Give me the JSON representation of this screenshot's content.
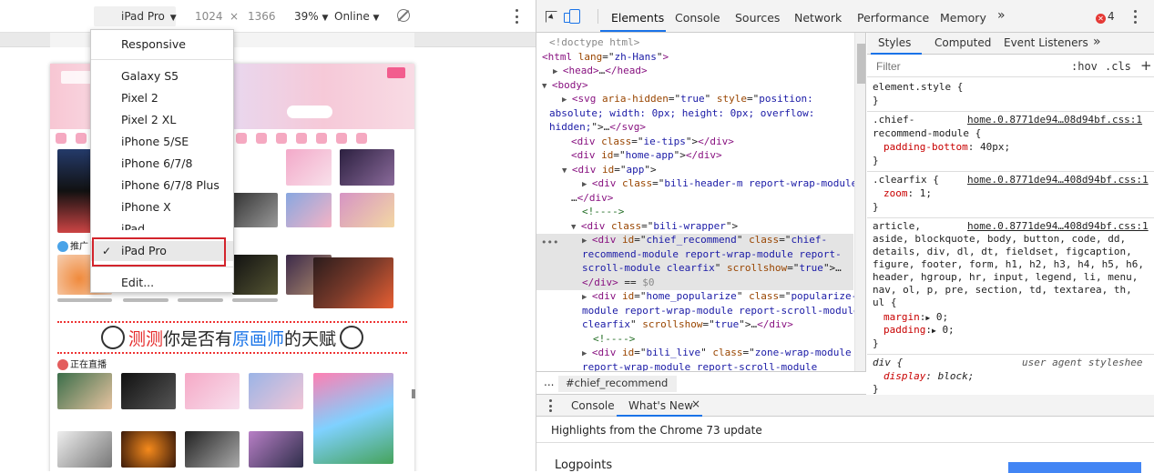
{
  "device_toolbar": {
    "device": "iPad Pro",
    "width": "1024",
    "times": "×",
    "height": "1366",
    "zoom": "39%",
    "network": "Online",
    "caret": "▼"
  },
  "device_menu": {
    "items": [
      "Responsive",
      "Galaxy S5",
      "Pixel 2",
      "Pixel 2 XL",
      "iPhone 5/SE",
      "iPhone 6/7/8",
      "iPhone 6/7/8 Plus",
      "iPhone X",
      "iPad",
      "iPad Pro",
      "Edit..."
    ],
    "selected": "iPad Pro",
    "check": "✓"
  },
  "page_preview": {
    "section_1": "推广",
    "section_2": "正在直播",
    "ad_parts": [
      "测测",
      "你是否有",
      "原画师",
      "的天赋"
    ]
  },
  "devtools": {
    "tabs": [
      "Elements",
      "Console",
      "Sources",
      "Network",
      "Performance",
      "Memory"
    ],
    "more": "»",
    "error_count": "4",
    "error_symbol": "✕"
  },
  "elements": {
    "lines": [
      {
        "parts": [
          [
            "g",
            "<!doctype html>"
          ]
        ]
      },
      {
        "parts": [
          [
            "t",
            "<html "
          ],
          [
            "a",
            "lang"
          ],
          [
            "k",
            "=\""
          ],
          [
            "v",
            "zh-Hans"
          ],
          [
            "k",
            "\""
          ],
          [
            "t",
            ">"
          ]
        ]
      },
      {
        "parts": [
          [
            "t",
            "<head>"
          ],
          [
            "k",
            "…"
          ],
          [
            "t",
            "</head>"
          ]
        ]
      },
      {
        "parts": [
          [
            "t",
            "<body>"
          ]
        ]
      },
      {
        "parts": [
          [
            "t",
            "<svg "
          ],
          [
            "a",
            "aria-hidden"
          ],
          [
            "k",
            "=\""
          ],
          [
            "v",
            "true"
          ],
          [
            "k",
            "\" "
          ],
          [
            "a",
            "style"
          ],
          [
            "k",
            "=\""
          ],
          [
            "v",
            "position:"
          ]
        ]
      },
      {
        "parts": [
          [
            "v",
            "absolute; width: 0px; height: 0px; overflow:"
          ]
        ]
      },
      {
        "parts": [
          [
            "v",
            "hidden;"
          ],
          [
            "k",
            "\">…"
          ],
          [
            "t",
            "</svg>"
          ]
        ]
      },
      {
        "parts": [
          [
            "t",
            "<div "
          ],
          [
            "a",
            "class"
          ],
          [
            "k",
            "=\""
          ],
          [
            "v",
            "ie-tips"
          ],
          [
            "k",
            "\">"
          ],
          [
            "t",
            "</div>"
          ]
        ]
      },
      {
        "parts": [
          [
            "t",
            "<div "
          ],
          [
            "a",
            "id"
          ],
          [
            "k",
            "=\""
          ],
          [
            "v",
            "home-app"
          ],
          [
            "k",
            "\">"
          ],
          [
            "t",
            "</div>"
          ]
        ]
      },
      {
        "parts": [
          [
            "t",
            "<div "
          ],
          [
            "a",
            "id"
          ],
          [
            "k",
            "=\""
          ],
          [
            "v",
            "app"
          ],
          [
            "k",
            "\">"
          ]
        ]
      },
      {
        "parts": [
          [
            "t",
            "<div "
          ],
          [
            "a",
            "class"
          ],
          [
            "k",
            "=\""
          ],
          [
            "v",
            "bili-header-m report-wrap-module"
          ],
          [
            "k",
            "\">"
          ]
        ]
      },
      {
        "parts": [
          [
            "k",
            "…"
          ],
          [
            "t",
            "</div>"
          ]
        ]
      },
      {
        "parts": [
          [
            "c",
            "<!---->"
          ]
        ]
      },
      {
        "parts": [
          [
            "t",
            "<div "
          ],
          [
            "a",
            "class"
          ],
          [
            "k",
            "=\""
          ],
          [
            "v",
            "bili-wrapper"
          ],
          [
            "k",
            "\">"
          ]
        ]
      },
      {
        "parts": [
          [
            "t",
            "<div "
          ],
          [
            "a",
            "id"
          ],
          [
            "k",
            "=\""
          ],
          [
            "v",
            "chief_recommend"
          ],
          [
            "k",
            "\" "
          ],
          [
            "a",
            "class"
          ],
          [
            "k",
            "=\""
          ],
          [
            "v",
            "chief-"
          ]
        ]
      },
      {
        "parts": [
          [
            "v",
            "recommend-module report-wrap-module report-"
          ]
        ]
      },
      {
        "parts": [
          [
            "v",
            "scroll-module clearfix"
          ],
          [
            "k",
            "\" "
          ],
          [
            "a",
            "scrollshow"
          ],
          [
            "k",
            "=\""
          ],
          [
            "v",
            "true"
          ],
          [
            "k",
            "\">…"
          ]
        ]
      },
      {
        "parts": [
          [
            "t",
            "</div>"
          ],
          [
            "k",
            " == "
          ],
          [
            "g",
            "$0"
          ]
        ]
      },
      {
        "parts": [
          [
            "t",
            "<div "
          ],
          [
            "a",
            "id"
          ],
          [
            "k",
            "=\""
          ],
          [
            "v",
            "home_popularize"
          ],
          [
            "k",
            "\" "
          ],
          [
            "a",
            "class"
          ],
          [
            "k",
            "=\""
          ],
          [
            "v",
            "popularize-"
          ]
        ]
      },
      {
        "parts": [
          [
            "v",
            "module report-wrap-module report-scroll-module"
          ]
        ]
      },
      {
        "parts": [
          [
            "v",
            "clearfix"
          ],
          [
            "k",
            "\" "
          ],
          [
            "a",
            "scrollshow"
          ],
          [
            "k",
            "=\""
          ],
          [
            "v",
            "true"
          ],
          [
            "k",
            "\">…"
          ],
          [
            "t",
            "</div>"
          ]
        ]
      },
      {
        "parts": [
          [
            "c",
            "<!---->"
          ]
        ]
      },
      {
        "parts": [
          [
            "t",
            "<div "
          ],
          [
            "a",
            "id"
          ],
          [
            "k",
            "=\""
          ],
          [
            "v",
            "bili_live"
          ],
          [
            "k",
            "\" "
          ],
          [
            "a",
            "class"
          ],
          [
            "k",
            "=\""
          ],
          [
            "v",
            "zone-wrap-module"
          ]
        ]
      },
      {
        "parts": [
          [
            "v",
            "report-wrap-module report-scroll-module"
          ]
        ]
      }
    ],
    "row_dots": "•••",
    "breadcrumb_dots": "...",
    "breadcrumb": "#chief_recommend"
  },
  "styles": {
    "tabs": [
      "Styles",
      "Computed",
      "Event Listeners"
    ],
    "more": "»",
    "filter_placeholder": "Filter",
    "hov": ":hov",
    "cls": ".cls",
    "add": "+",
    "rules": {
      "r1_sel": "element.style {",
      "close": "}",
      "r2_sel_a": ".chief-",
      "r2_sel_b": "recommend-module {",
      "r2_src": "home.0.8771de94…08d94bf.css:1",
      "r2_prop": "padding-bottom",
      "r2_val": "40px;",
      "r3_sel": ".clearfix {",
      "r3_src": "home.0.8771de94…408d94bf.css:1",
      "r3_prop": "zoom",
      "r3_val": "1;",
      "r4_sel": "article,",
      "r4_src": "home.0.8771de94…408d94bf.css:1",
      "r4_l2": "aside, blockquote, body, button, code, dd,",
      "r4_l3": "details, div, dl, dt, fieldset, figcaption,",
      "r4_l4": "figure, footer, form, h1, h2, h3, h4, h5, h6,",
      "r4_l5": "header, hgroup, hr, input, legend, li, menu,",
      "r4_l6": "nav, ol, p, pre, section, td, textarea, th,",
      "r4_l7": "ul {",
      "r4_p1": "margin",
      "r4_v1": "0;",
      "r4_p2": "padding",
      "r4_v2": "0;",
      "r5_sel": "div {",
      "r5_src": "user agent styleshee",
      "r5_prop": "display",
      "r5_val": "block;"
    }
  },
  "drawer": {
    "tabs": [
      "Console",
      "What's New"
    ],
    "close": "×",
    "highlights": "Highlights from the Chrome 73 update",
    "logpoints": "Logpoints"
  }
}
